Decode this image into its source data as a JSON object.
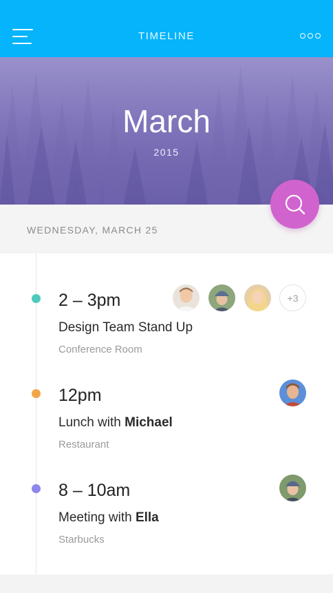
{
  "header": {
    "title": "TIMELINE",
    "menu_icon": "hamburger-menu-icon",
    "more_icon": "more-dots-icon",
    "background_color": "#05b4fb"
  },
  "hero": {
    "month": "March",
    "year": "2015"
  },
  "search_button": {
    "icon": "search-icon",
    "color": "#d163cf"
  },
  "date_header": {
    "label": "WEDNESDAY, MARCH 25"
  },
  "events": [
    {
      "time": "2 – 3pm",
      "title_plain": "Design Team Stand Up",
      "title_bold": "",
      "location": "Conference Room",
      "dot_color": "#4ccabc",
      "attendees": [
        "avatar-man-light",
        "avatar-woman-beanie",
        "avatar-woman-blonde"
      ],
      "extra_attendees": "+3"
    },
    {
      "time": "12pm",
      "title_plain": "Lunch with ",
      "title_bold": "Michael",
      "location": "Restaurant",
      "dot_color": "#f3a54a",
      "attendees": [
        "avatar-michael"
      ]
    },
    {
      "time": "8 – 10am",
      "title_plain": "Meeting with ",
      "title_bold": "Ella",
      "location": "Starbucks",
      "dot_color": "#8e86ea",
      "attendees": [
        "avatar-ella"
      ]
    }
  ]
}
